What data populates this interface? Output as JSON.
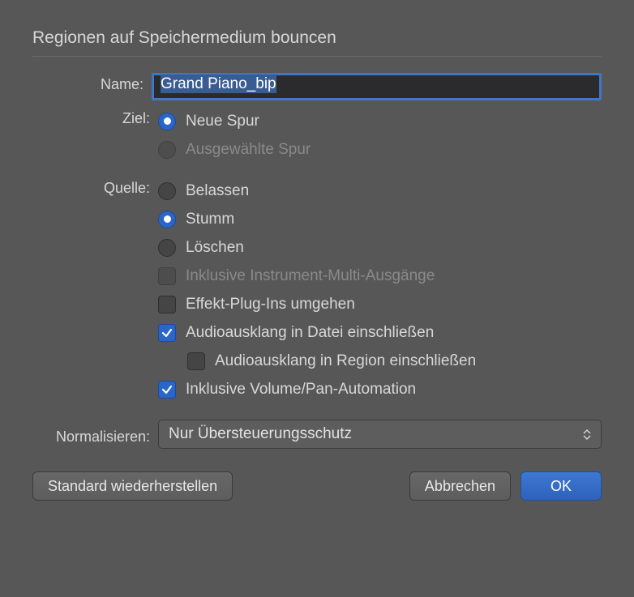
{
  "dialog": {
    "title": "Regionen auf Speichermedium bouncen"
  },
  "name": {
    "label": "Name:",
    "value": "Grand Piano_bip"
  },
  "ziel": {
    "label": "Ziel:",
    "options": {
      "neue_spur": "Neue Spur",
      "ausgewaehlte_spur": "Ausgewählte Spur"
    }
  },
  "quelle": {
    "label": "Quelle:",
    "options": {
      "belassen": "Belassen",
      "stumm": "Stumm",
      "loeschen": "Löschen"
    }
  },
  "checks": {
    "multi_ausgaenge": "Inklusive Instrument-Multi-Ausgänge",
    "plugins_umgehen": "Effekt-Plug-Ins umgehen",
    "audio_datei": "Audioausklang in Datei einschließen",
    "audio_region": "Audioausklang in Region einschließen",
    "volume_pan": "Inklusive Volume/Pan-Automation"
  },
  "normalisieren": {
    "label": "Normalisieren:",
    "value": "Nur Übersteuerungsschutz"
  },
  "buttons": {
    "restore": "Standard wiederherstellen",
    "cancel": "Abbrechen",
    "ok": "OK"
  }
}
